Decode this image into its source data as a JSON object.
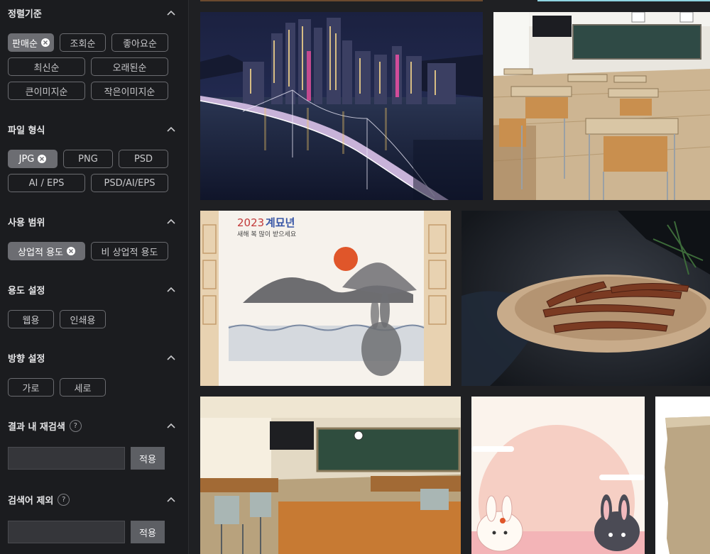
{
  "sort": {
    "title": "정렬기준",
    "options": [
      "판매순",
      "조회순",
      "좋아요순",
      "최신순",
      "오래된순",
      "큰이미지순",
      "작은이미지순"
    ],
    "active": "판매순"
  },
  "file_type": {
    "title": "파일 형식",
    "options": [
      "JPG",
      "PNG",
      "PSD",
      "AI / EPS",
      "PSD/AI/EPS"
    ],
    "active": "JPG"
  },
  "usage_scope": {
    "title": "사용 범위",
    "options": [
      "상업적 용도",
      "비 상업적 용도"
    ],
    "active": "상업적 용도"
  },
  "purpose": {
    "title": "용도 설정",
    "options": [
      "웹용",
      "인쇄용"
    ]
  },
  "orientation": {
    "title": "방향 설정",
    "options": [
      "가로",
      "세로"
    ]
  },
  "refine": {
    "title": "결과 내 재검색",
    "help": "?",
    "value": "",
    "apply_label": "적용"
  },
  "exclude": {
    "title": "검색어 제외",
    "help": "?",
    "value": "",
    "apply_label": "적용"
  },
  "card": {
    "year": "2023",
    "headline": "계묘년",
    "greeting": "새해 복 많이 받으세요"
  },
  "colors": {
    "sidebar_bg": "#1b1c1f",
    "chip_active_bg": "#6c6d72",
    "apply_bg": "#5d5f64",
    "card_accent": "#e0562a"
  }
}
